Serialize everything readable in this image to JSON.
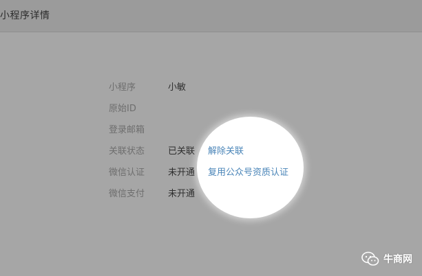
{
  "header": {
    "title": "小程序详情"
  },
  "details": {
    "rows": [
      {
        "label": "小程序",
        "value": "小敏"
      },
      {
        "label": "原始ID",
        "value": ""
      },
      {
        "label": "登录邮箱",
        "value": ""
      },
      {
        "label": "关联状态",
        "value": "已关联"
      },
      {
        "label": "微信认证",
        "value": "未开通"
      },
      {
        "label": "微信支付",
        "value": "未开通"
      }
    ]
  },
  "actions": {
    "unlink": "解除关联",
    "reuse_certification": "复用公众号资质认证"
  },
  "watermark": {
    "text": "牛商网"
  },
  "colors": {
    "link": "#4a85b8",
    "background": "#a6a6a6",
    "spotlight": "#ffffff"
  }
}
